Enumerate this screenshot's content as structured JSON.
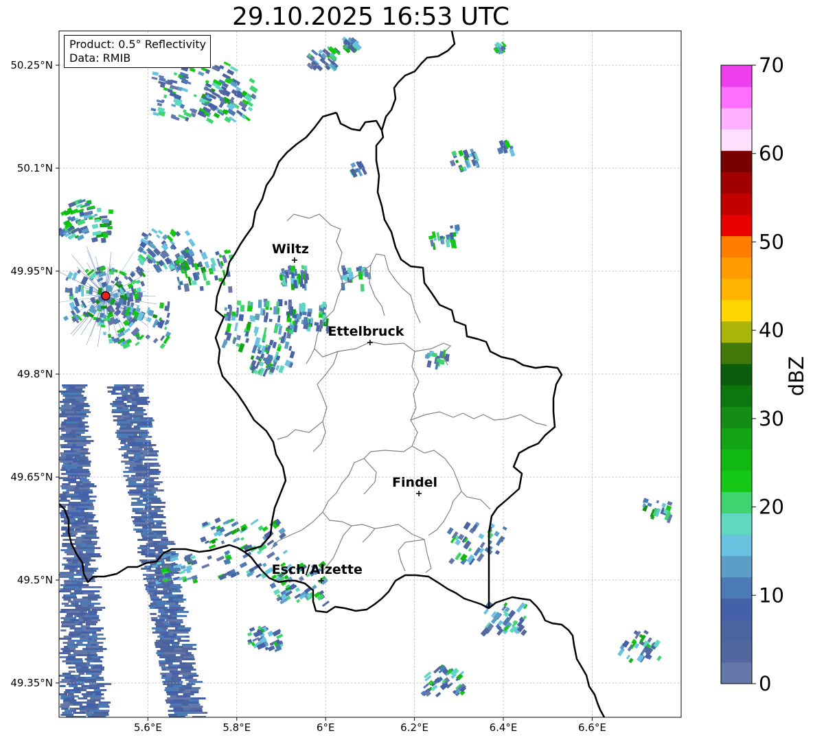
{
  "title": "29.10.2025 16:53 UTC",
  "info_box": {
    "product": "Product: 0.5° Reflectivity",
    "source": "Data: RMIB"
  },
  "axes": {
    "x_ticks": [
      "5.6°E",
      "5.8°E",
      "6°E",
      "6.2°E",
      "6.4°E",
      "6.6°E"
    ],
    "y_ticks": [
      "50.25°N",
      "50.1°N",
      "49.95°N",
      "49.8°N",
      "49.65°N",
      "49.5°N",
      "49.35°N"
    ]
  },
  "cities": [
    {
      "name": "Wiltz",
      "lon": 5.93,
      "lat": 49.966
    },
    {
      "name": "Ettelbruck",
      "lon": 6.1,
      "lat": 49.846
    },
    {
      "name": "Findel",
      "lon": 6.21,
      "lat": 49.626
    },
    {
      "name": "Esch/Alzette",
      "lon": 5.99,
      "lat": 49.499
    }
  ],
  "radar_site": {
    "lon": 5.505,
    "lat": 49.914,
    "color": "#e8231f"
  },
  "colorbar": {
    "label": "dBZ",
    "min": 0,
    "max": 70,
    "ticks": [
      "0",
      "10",
      "20",
      "30",
      "40",
      "50",
      "60",
      "70"
    ],
    "colors": [
      "#6577a9",
      "#5267a0",
      "#4a64a0",
      "#4360a8",
      "#4b7ab5",
      "#5c9ec8",
      "#69c2e0",
      "#60d8c0",
      "#40d470",
      "#16c816",
      "#12b812",
      "#13a513",
      "#138d13",
      "#0d760d",
      "#0b5e0b",
      "#427a0a",
      "#aab40a",
      "#ffd700",
      "#ffb400",
      "#ff9c00",
      "#ff7d00",
      "#e80000",
      "#c20000",
      "#a00000",
      "#7a0000",
      "#ffe0ff",
      "#ffb0ff",
      "#ff70ff",
      "#ee3fee"
    ]
  },
  "colors": {
    "border_country": "#000000",
    "border_canton": "#808080",
    "grid": "#bbbbbb"
  }
}
